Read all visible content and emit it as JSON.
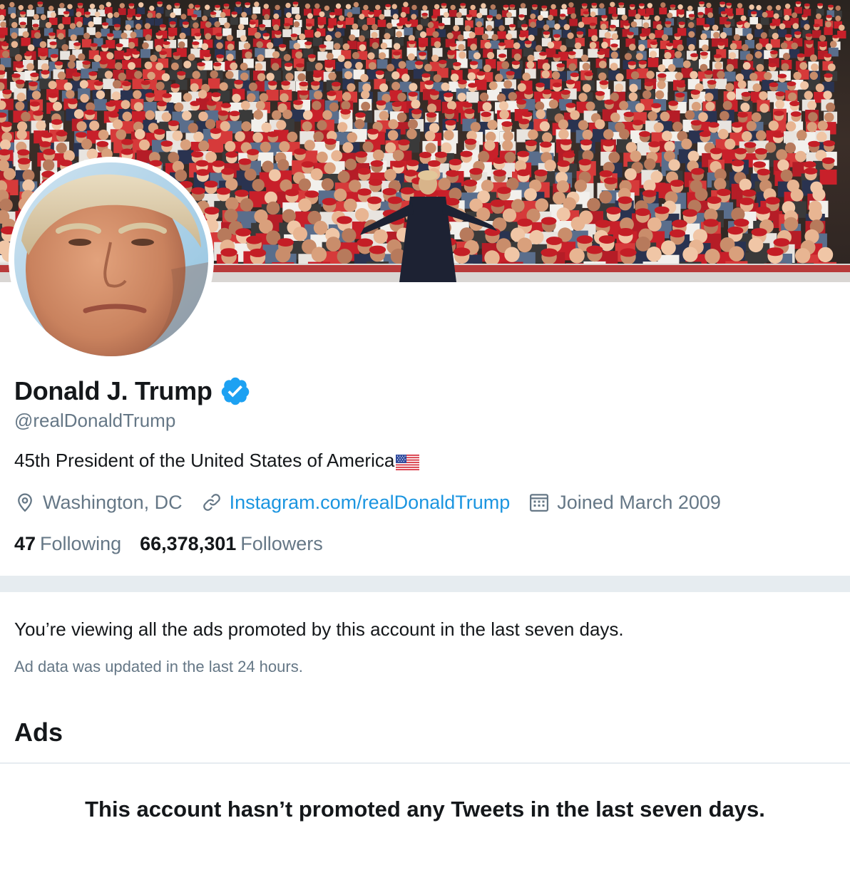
{
  "profile": {
    "display_name": "Donald J. Trump",
    "verified": true,
    "handle": "@realDonaldTrump",
    "bio": "45th President of the United States of America",
    "bio_emoji": "us-flag",
    "location": "Washington, DC",
    "website": "Instagram.com/realDonaldTrump",
    "joined": "Joined March 2009",
    "following_count": "47",
    "following_label": "Following",
    "followers_count": "66,378,301",
    "followers_label": "Followers"
  },
  "icons": {
    "location": "location-pin-icon",
    "website": "link-icon",
    "joined": "calendar-icon",
    "verified": "verified-badge-icon"
  },
  "ads_section": {
    "notice": "You’re viewing all the ads promoted by this account in the last seven days.",
    "updated": "Ad data was updated in the last 24 hours.",
    "heading": "Ads",
    "empty_message": "This account hasn’t promoted any Tweets in the last seven days."
  },
  "colors": {
    "primary_text": "#14171a",
    "secondary_text": "#657786",
    "link": "#1b95e0",
    "verified_blue": "#1da1f2",
    "separator": "#e6ecf0"
  }
}
